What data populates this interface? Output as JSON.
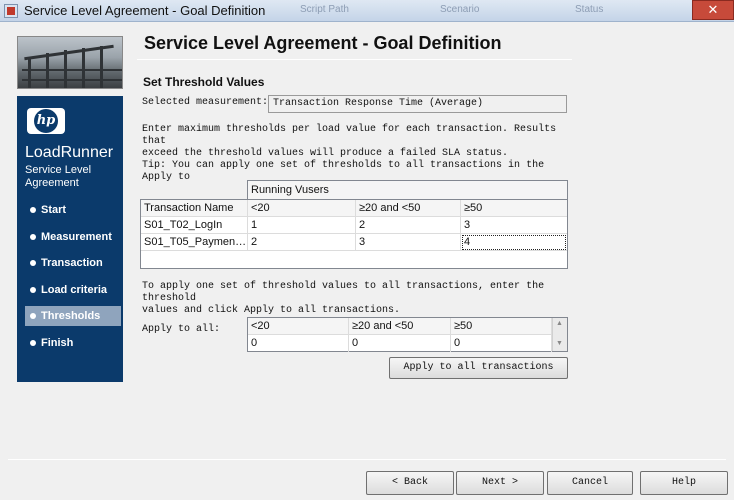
{
  "window": {
    "title": "Service Level Agreement - Goal Definition",
    "close_glyph": "✕",
    "background_tabs": [
      "Script Path",
      "Scenario",
      "Status"
    ]
  },
  "sidebar": {
    "logo_text": "hp",
    "brand": "LoadRunner",
    "subtitle": "Service Level Agreement",
    "items": [
      {
        "label": "Start"
      },
      {
        "label": "Measurement"
      },
      {
        "label": "Transaction"
      },
      {
        "label": "Load criteria"
      },
      {
        "label": "Thresholds",
        "active": true
      },
      {
        "label": "Finish"
      }
    ]
  },
  "main": {
    "heading": "Service Level Agreement - Goal Definition",
    "section_title": "Set Threshold Values",
    "selected_measurement_label": "Selected measurement:",
    "selected_measurement_value": "Transaction Response Time (Average)",
    "instructions_line1": "Enter maximum thresholds per load value for each transaction. Results that",
    "instructions_line2": "exceed the threshold values will produce a failed SLA status.",
    "tip": "Tip: You can apply one set of thresholds to all transactions in the Apply to"
  },
  "threshold_table": {
    "group_header": "Running Vusers",
    "columns": [
      "Transaction Name",
      "<20",
      "≥20 and <50",
      "≥50"
    ],
    "rows": [
      [
        "S01_T02_LogIn",
        "1",
        "2",
        "3"
      ],
      [
        "S01_T05_Paymen…",
        "2",
        "3",
        "4"
      ]
    ]
  },
  "apply_all": {
    "instructions_line1": "To apply one set of threshold values to all transactions, enter the threshold",
    "instructions_line2": "values and click Apply to all transactions.",
    "label": "Apply to all:",
    "columns": [
      "<20",
      "≥20 and <50",
      "≥50"
    ],
    "values": [
      "0",
      "0",
      "0"
    ],
    "button_label": "Apply to all transactions"
  },
  "footer": {
    "back_label": "Back",
    "next_label": "Next",
    "cancel_label": "Cancel",
    "help_label": "Help"
  },
  "colors": {
    "sidebar_bg": "#0b3a6b",
    "sidebar_active": "#8fa4bd",
    "close_button": "#c74a3a"
  }
}
